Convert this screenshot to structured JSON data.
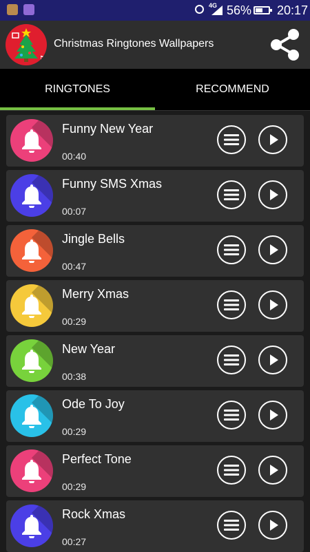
{
  "status_bar": {
    "network": "4G",
    "battery_percent": "56%",
    "battery_level": 0.56,
    "time": "20:17",
    "left_icons": [
      "notification-app-icon",
      "gallery-app-icon"
    ]
  },
  "app_bar": {
    "title": "Christmas Ringtones Wallpapers",
    "logo_icon": "christmas-tree-icon",
    "share_icon": "share-icon"
  },
  "tabs": [
    {
      "label": "RINGTONES",
      "selected": true
    },
    {
      "label": "RECOMMEND",
      "selected": false
    }
  ],
  "colors": {
    "accent": "#76c043",
    "app_bar": "#2e2e2e",
    "row_bg": "#313131"
  },
  "ringtones": [
    {
      "title": "Funny New Year",
      "duration": "00:40",
      "color": "#ec407a"
    },
    {
      "title": "Funny SMS Xmas",
      "duration": "00:07",
      "color": "#4b3fe6"
    },
    {
      "title": "Jingle Bells",
      "duration": "00:47",
      "color": "#f4623a"
    },
    {
      "title": "Merry Xmas",
      "duration": "00:29",
      "color": "#f5c93b"
    },
    {
      "title": "New Year",
      "duration": "00:38",
      "color": "#78d23c"
    },
    {
      "title": "Ode To Joy",
      "duration": "00:29",
      "color": "#29c1e8"
    },
    {
      "title": "Perfect Tone",
      "duration": "00:29",
      "color": "#ec407a"
    },
    {
      "title": "Rock Xmas",
      "duration": "00:27",
      "color": "#4b3fe6"
    }
  ]
}
